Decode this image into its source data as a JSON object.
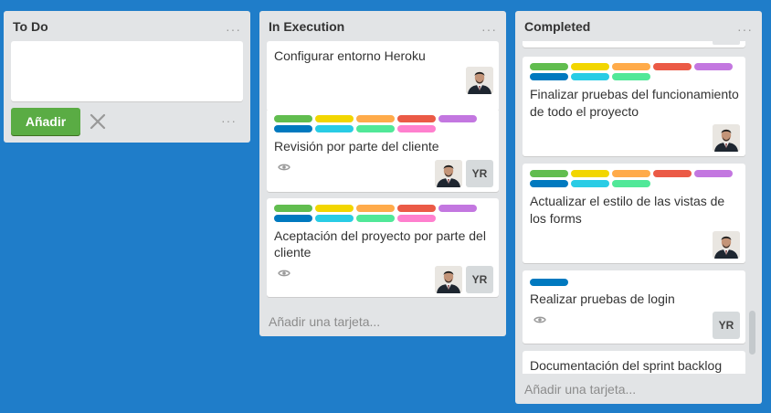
{
  "colors": {
    "board_bg": "#1f7dc9",
    "green": "#61bd4f",
    "yellow": "#f2d600",
    "orange": "#ffab4a",
    "red": "#eb5a46",
    "purple": "#c377e0",
    "blue": "#0079bf",
    "sky": "#29cce5",
    "lime": "#51e898",
    "pink": "#ff80ce",
    "add_button": "#5aac44"
  },
  "lists": {
    "todo": {
      "title": "To Do",
      "menu": "···",
      "add_button_label": "Añadir",
      "composer_menu": "···"
    },
    "execution": {
      "title": "In Execution",
      "menu": "···",
      "add_card": "Añadir una tarjeta...",
      "cards": [
        {
          "title": "Configurar entorno Heroku"
        },
        {
          "title": "Revisión por parte del cliente",
          "initials": "YR"
        },
        {
          "title_line1": "Aceptación del proyecto por parte del",
          "title_line2": "cliente",
          "initials": "YR"
        }
      ]
    },
    "completed": {
      "title": "Completed",
      "menu": "···",
      "add_card": "Añadir una tarjeta...",
      "cards": [
        {
          "title_line1": "Finalizar pruebas del funcionamiento",
          "title_line2": "de todo el proyecto"
        },
        {
          "title_line1": "Actualizar el estilo de las vistas de",
          "title_line2": "los forms"
        },
        {
          "title": "Realizar pruebas de login",
          "initials": "YR"
        },
        {
          "title": "Documentación del sprint backlog"
        }
      ]
    }
  }
}
